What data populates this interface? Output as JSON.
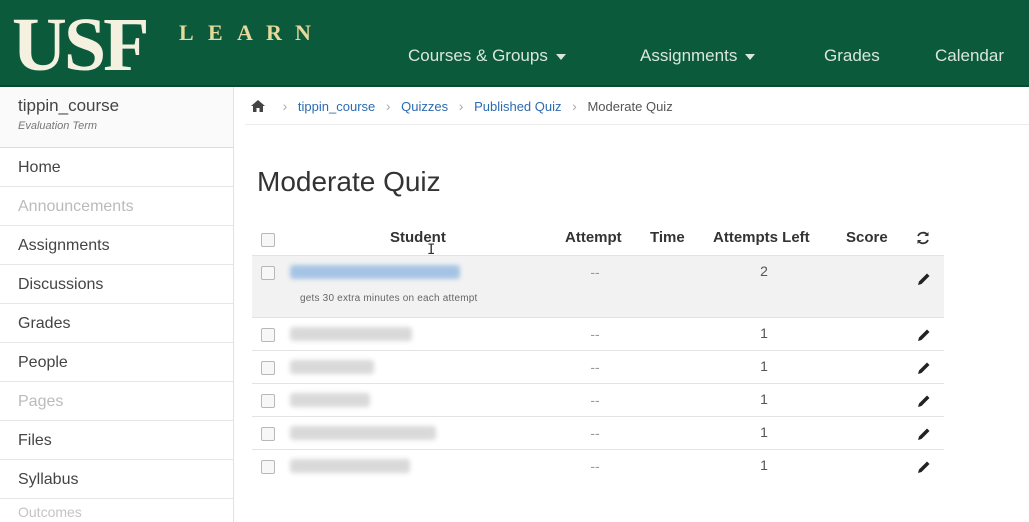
{
  "header": {
    "logo_primary": "USF",
    "logo_letters": [
      "L",
      "E",
      "A",
      "R",
      "N"
    ],
    "nav": [
      {
        "label": "Courses & Groups",
        "dropdown": true
      },
      {
        "label": "Assignments",
        "dropdown": true
      },
      {
        "label": "Grades",
        "dropdown": false
      },
      {
        "label": "Calendar",
        "dropdown": false
      }
    ],
    "colors": {
      "bar": "#0b5a3c",
      "logo_gold": "#e6d99c"
    }
  },
  "sidebar": {
    "course_name": "tippin_course",
    "term": "Evaluation Term",
    "items": [
      {
        "label": "Home",
        "enabled": true
      },
      {
        "label": "Announcements",
        "enabled": false
      },
      {
        "label": "Assignments",
        "enabled": true
      },
      {
        "label": "Discussions",
        "enabled": true
      },
      {
        "label": "Grades",
        "enabled": true
      },
      {
        "label": "People",
        "enabled": true
      },
      {
        "label": "Pages",
        "enabled": false
      },
      {
        "label": "Files",
        "enabled": true
      },
      {
        "label": "Syllabus",
        "enabled": true
      },
      {
        "label": "Outcomes",
        "enabled": false
      }
    ]
  },
  "breadcrumb": {
    "icon": "home-icon",
    "items": [
      {
        "label": "tippin_course",
        "link": true
      },
      {
        "label": "Quizzes",
        "link": true
      },
      {
        "label": "Published Quiz",
        "link": true
      },
      {
        "label": "Moderate Quiz",
        "link": false
      }
    ]
  },
  "page": {
    "title": "Moderate Quiz"
  },
  "table": {
    "headers": {
      "student": "Student",
      "attempt": "Attempt",
      "time": "Time",
      "attempts_left": "Attempts Left",
      "score": "Score"
    },
    "rows": [
      {
        "attempt": "--",
        "attempts_left": "2",
        "note": "gets 30 extra minutes on each attempt",
        "highlight": true
      },
      {
        "attempt": "--",
        "attempts_left": "1"
      },
      {
        "attempt": "--",
        "attempts_left": "1"
      },
      {
        "attempt": "--",
        "attempts_left": "1"
      },
      {
        "attempt": "--",
        "attempts_left": "1"
      },
      {
        "attempt": "--",
        "attempts_left": "1"
      }
    ]
  }
}
